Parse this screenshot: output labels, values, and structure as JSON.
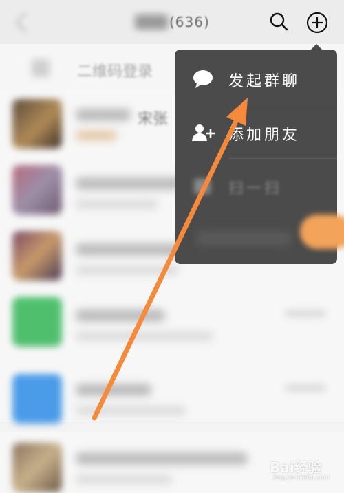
{
  "header": {
    "title_suffix": "(636)"
  },
  "notice": {
    "text": "二维码登录"
  },
  "chats": [
    {
      "name_hint": "宋张"
    }
  ],
  "menu": {
    "items": [
      {
        "label": "发起群聊",
        "icon": "chat-bubble-icon"
      },
      {
        "label": "添加朋友",
        "icon": "add-friend-icon"
      },
      {
        "label": "扫一扫",
        "icon": "scan-icon"
      }
    ]
  },
  "colors": {
    "menu_bg": "#4b4b4b",
    "arrow": "#f68a3c",
    "page_bg": "#f3f3f3"
  },
  "watermark": {
    "brand": "Bai经验",
    "url": "jingyan.baidu.com"
  }
}
